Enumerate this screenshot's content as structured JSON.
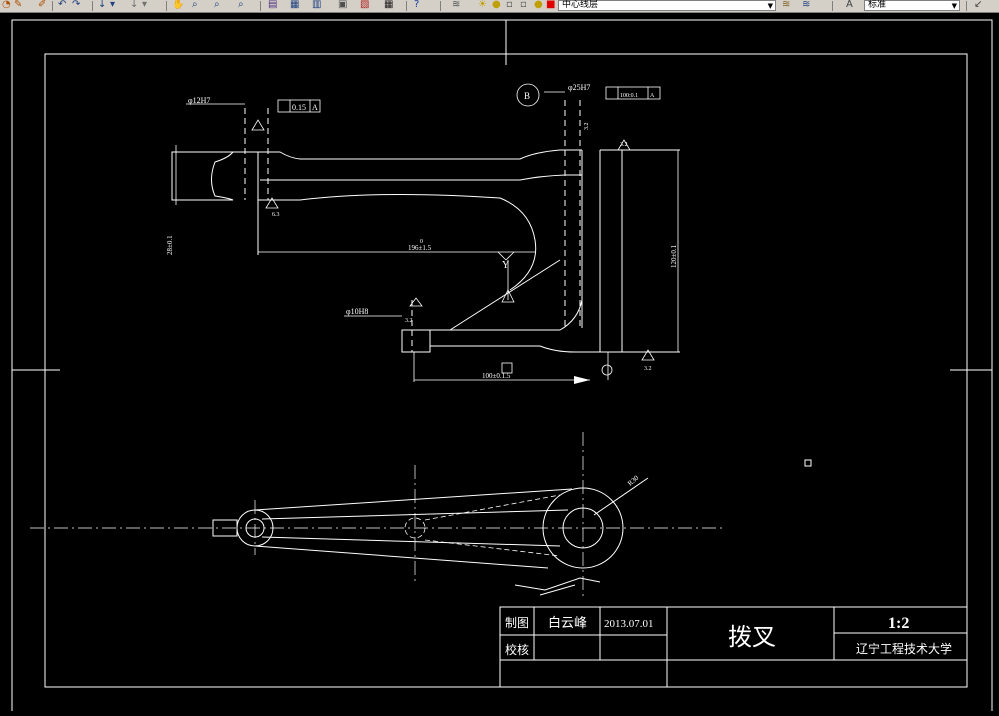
{
  "toolbar": {
    "layer_combo_value": "中心线层",
    "style_combo_value": "标准",
    "icons": [
      "properties-icon",
      "undo-icon",
      "redo-icon",
      "pan-icon",
      "zoom-realtime-icon",
      "zoom-window-icon",
      "zoom-previous-icon",
      "properties-palette-icon",
      "design-center-icon",
      "tool-palette-icon",
      "sheet-set-icon",
      "markup-icon",
      "calculator-icon",
      "help-icon",
      "layer-manager-icon",
      "layer-state-icon",
      "color-icon",
      "text-style-icon"
    ]
  },
  "drawing": {
    "dims": {
      "bore_small_top": "φ12H7",
      "tolerance_parallel": "0.15",
      "datum_a": "A",
      "bore_large_top": "φ25H7",
      "datum_b": "B",
      "tolerance_perp": "100:0.1",
      "datum_a2": "A",
      "roughness_1": "3.2",
      "roughness_2": "6.3",
      "roughness_3": "3.2",
      "roughness_4": "3.2",
      "roughness_5": "3.2",
      "length_dim": "196±1.5",
      "length_dim_top": "0",
      "height_dim": "120±0.1",
      "thickness_dim": "28±0.1",
      "pin_bore": "φ10H8",
      "bottom_dim": "100±0.1.5",
      "radius_dim": "R30",
      "view_label": "Y"
    },
    "title_block": {
      "drawn_label": "制图",
      "drawn_name": "白云峰",
      "drawn_date": "2013.07.01",
      "checked_label": "校核",
      "part_name": "拨叉",
      "scale": "1:2",
      "school": "辽宁工程技术大学"
    }
  }
}
